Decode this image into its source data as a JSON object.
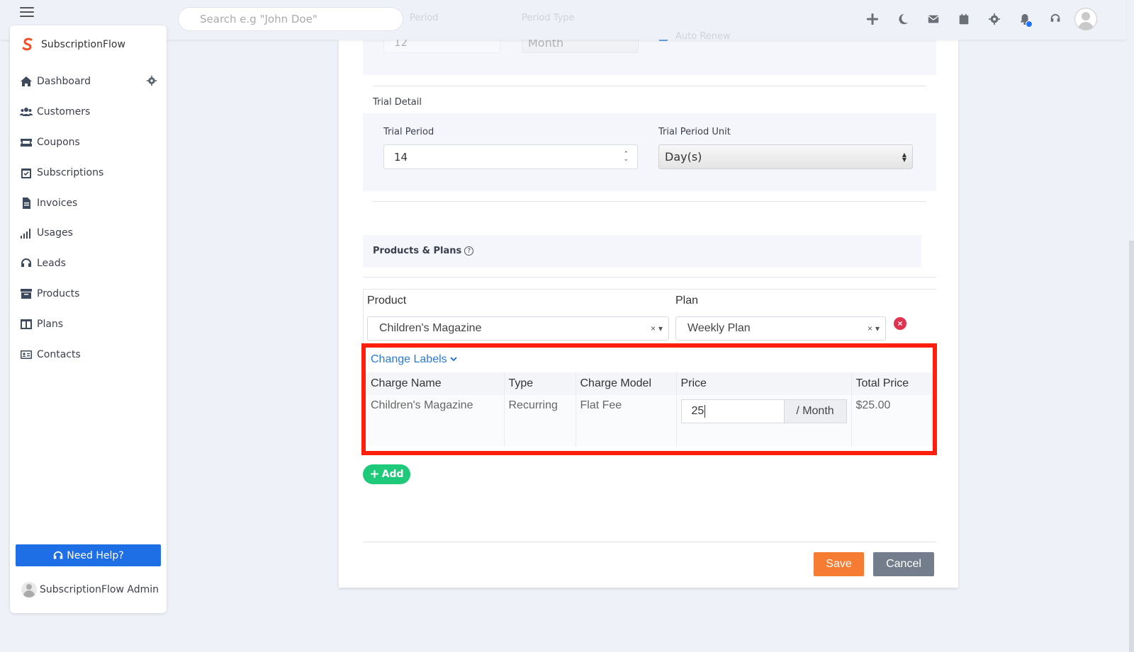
{
  "topbar": {
    "search_placeholder": "Search e.g \"John Doe\"",
    "icons": [
      "plus-icon",
      "moon-icon",
      "mail-icon",
      "calendar-icon",
      "gear-icon",
      "bell-icon",
      "headset-icon",
      "user-avatar"
    ]
  },
  "sidebar": {
    "brand": "SubscriptionFlow",
    "items": [
      {
        "label": "Dashboard",
        "icon": "home-icon"
      },
      {
        "label": "Customers",
        "icon": "users-icon"
      },
      {
        "label": "Coupons",
        "icon": "coupon-icon"
      },
      {
        "label": "Subscriptions",
        "icon": "calendar-check-icon"
      },
      {
        "label": "Invoices",
        "icon": "invoice-icon"
      },
      {
        "label": "Usages",
        "icon": "signal-icon"
      },
      {
        "label": "Leads",
        "icon": "headset-icon"
      },
      {
        "label": "Products",
        "icon": "archive-icon"
      },
      {
        "label": "Plans",
        "icon": "columns-icon"
      },
      {
        "label": "Contacts",
        "icon": "address-card-icon"
      }
    ],
    "help_label": "Need Help?",
    "admin_name": "SubscriptionFlow Admin"
  },
  "form": {
    "billing": {
      "period_label": "Period",
      "period_type_label": "Period Type",
      "period_value": "12",
      "period_type_value": "Month",
      "auto_renew_label": "Auto Renew"
    },
    "trial": {
      "section_label": "Trial Detail",
      "period_label": "Trial Period",
      "period_value": "14",
      "unit_label": "Trial Period Unit",
      "unit_value": "Day(s)"
    },
    "products_plans": {
      "title": "Products & Plans",
      "product_header": "Product",
      "plan_header": "Plan",
      "product_value": "Children's Magazine",
      "plan_value": "Weekly Plan",
      "change_labels": "Change Labels",
      "charges": {
        "headers": [
          "Charge Name",
          "Type",
          "Charge Model",
          "Price",
          "Total Price"
        ],
        "rows": [
          {
            "charge_name": "Children's Magazine",
            "type": "Recurring",
            "charge_model": "Flat Fee",
            "price": "25",
            "price_unit": "/ Month",
            "total_price": "$25.00"
          }
        ]
      },
      "add_label": "Add"
    },
    "actions": {
      "save": "Save",
      "cancel": "Cancel"
    }
  },
  "colors": {
    "highlight": "#ff1f0f",
    "primary": "#1e6fe6",
    "save": "#f77c33",
    "cancel": "#737d8c",
    "add": "#1ec979",
    "link": "#2a7ad8"
  }
}
